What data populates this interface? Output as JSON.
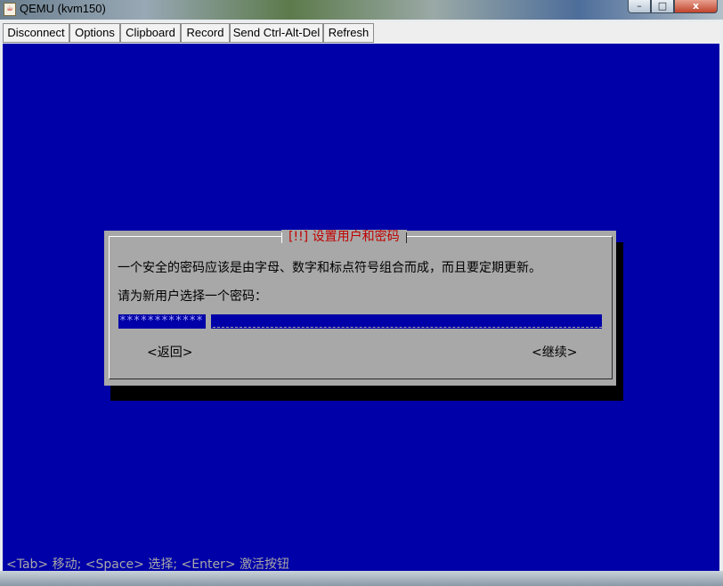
{
  "window": {
    "title": "QEMU (kvm150)",
    "app_icon": "java-cup-icon",
    "controls": {
      "minimize": "–",
      "maximize": "□",
      "close": "x"
    }
  },
  "toolbar": {
    "buttons": [
      "Disconnect",
      "Options",
      "Clipboard",
      "Record",
      "Send Ctrl-Alt-Del",
      "Refresh"
    ]
  },
  "dialog": {
    "title": "[!!] 设置用户和密码",
    "message": "一个安全的密码应该是由字母、数字和标点符号组合而成，而且要定期更新。",
    "prompt": "请为新用户选择一个密码：",
    "password_value": "************",
    "back_label": "<返回>",
    "continue_label": "<继续>"
  },
  "status_bar": {
    "hint": "<Tab> 移动; <Space> 选择; <Enter> 激活按钮"
  },
  "colors": {
    "console_bg": "#0000a8",
    "dialog_bg": "#a8a8a8",
    "dialog_title": "#c00000"
  }
}
